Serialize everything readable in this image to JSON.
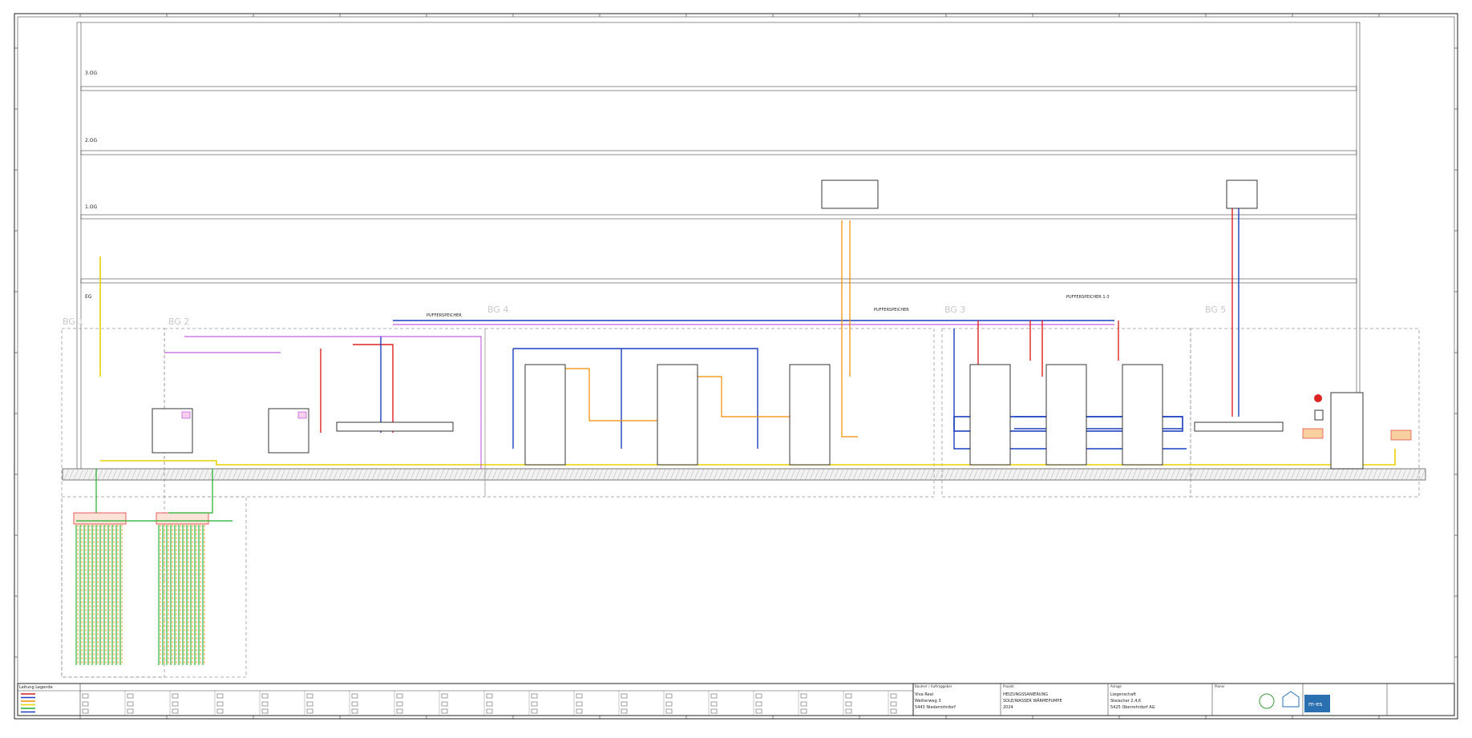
{
  "floors": [
    "3.OG",
    "2.OG",
    "1.OG",
    "EG"
  ],
  "groups": [
    "BG 1",
    "BG 2",
    "BG 4",
    "BG 3",
    "BG 5"
  ],
  "storages": [
    {
      "label": "PUFFERSPEICHER"
    },
    {
      "label": "PUFFERSPEICHER"
    },
    {
      "label": "PUFFERSPEICHER 1-3"
    }
  ],
  "titleblock": {
    "client_label": "Bauherr / Auftraggeber",
    "client_name": "Viva Real",
    "client_street": "Weiherweg 3",
    "client_city": "5443 Niederrohrdorf",
    "project_label": "Projekt",
    "project_line1": "HEIZUNGSSANIERUNG",
    "project_line2": "SOLE/WASSER WÄRMEPUMPE",
    "project_year": "2024",
    "site_label": "Anlage",
    "site_name": "Liegenschaft",
    "site_street": "Steiacher 2,4,6",
    "site_city": "5425 Oberrohrdorf AG",
    "planner_label": "Planer",
    "logo_text": "m-es"
  },
  "legend_heading": "Leitung Legende",
  "colors": {
    "supply": "#d22222",
    "return": "#1c3fbf",
    "warm_water": "#f08c00",
    "gas_line": "#e8d200",
    "brine": "#1fae2a",
    "sensor": "#b03cd8"
  }
}
